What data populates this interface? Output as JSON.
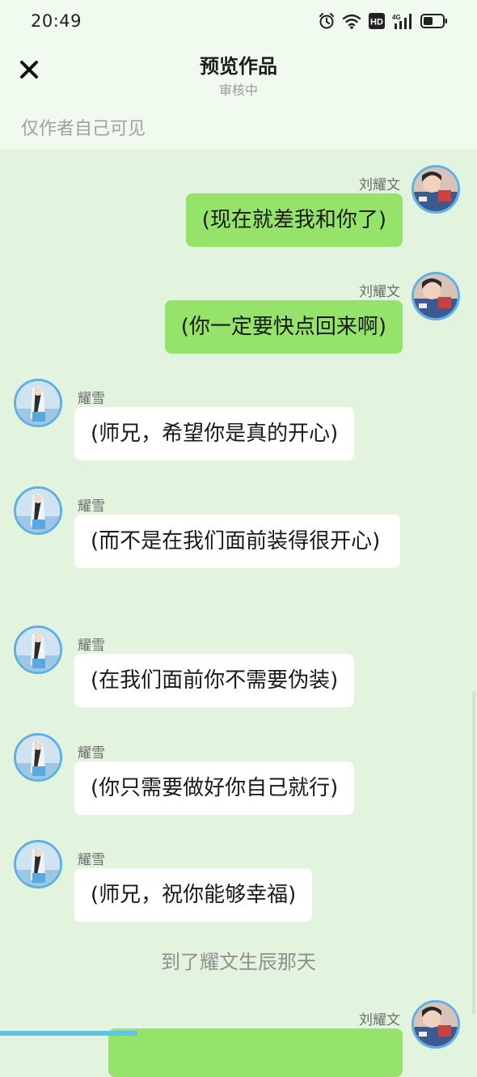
{
  "status_bar": {
    "time": "20:49",
    "icons": [
      "alarm-icon",
      "wifi-icon",
      "hd-icon",
      "signal-4g-icon",
      "battery-icon"
    ],
    "network_label": "4G",
    "hd_label": "HD"
  },
  "header": {
    "close_icon": "close-icon",
    "title": "预览作品",
    "subtitle": "审核中"
  },
  "visibility": {
    "text": "仅作者自己可见"
  },
  "colors": {
    "background": "#e2f3de",
    "bar_background": "#f0faee",
    "right_bubble": "#95e36a",
    "left_bubble": "#ffffff",
    "avatar_border": "#5fb0e8"
  },
  "messages": [
    {
      "side": "right",
      "sender": "刘耀文",
      "text": "(现在就差我和你了)"
    },
    {
      "side": "right",
      "sender": "刘耀文",
      "text": "(你一定要快点回来啊)"
    },
    {
      "side": "left",
      "sender": "耀雪",
      "text": "(师兄，希望你是真的开心)"
    },
    {
      "side": "left",
      "sender": "耀雪",
      "text": "(而不是在我们面前装得很开心)"
    },
    {
      "side": "left",
      "sender": "耀雪",
      "text": "(在我们面前你不需要伪装)"
    },
    {
      "side": "left",
      "sender": "耀雪",
      "text": "(你只需要做好你自己就行)"
    },
    {
      "side": "left",
      "sender": "耀雪",
      "text": "(师兄，祝你能够幸福)"
    },
    {
      "side": "right",
      "sender": "刘耀文",
      "text": ""
    }
  ],
  "narration": "到了耀文生辰那天"
}
